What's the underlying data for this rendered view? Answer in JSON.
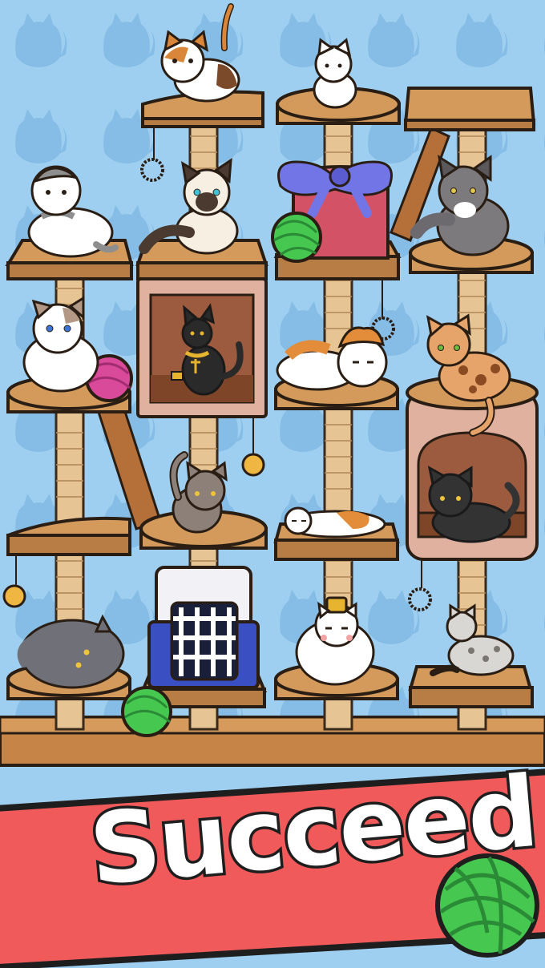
{
  "screen": {
    "title": "Succeed"
  },
  "colors": {
    "sky": "#9fcff0",
    "wallpaper_pattern": "#86bde6",
    "wood": "#d39a5c",
    "wood_edge": "#3a2a1c",
    "rope": "#e6c493",
    "banner_red": "#f05a5a",
    "yarn_green": "#45c750",
    "yarn_pink": "#d94a9a",
    "gift_box": "#d45266",
    "gift_ribbon": "#7275e6",
    "carrier_blue": "#3a4fc2",
    "cat_house": "#e1b1a0"
  },
  "cats": [
    {
      "name": "calico",
      "on": "top-left-platform"
    },
    {
      "name": "white",
      "on": "top-middle-platform"
    },
    {
      "name": "scottish-fold",
      "on": "left-platform-1"
    },
    {
      "name": "siamese",
      "on": "cat-house-roof"
    },
    {
      "name": "maine-coon",
      "on": "right-platform-1"
    },
    {
      "name": "ragdoll",
      "on": "left-platform-2"
    },
    {
      "name": "egyptian-bastet",
      "on": "cat-house"
    },
    {
      "name": "exotic-shorthair",
      "on": "middle-platform-2"
    },
    {
      "name": "bengal",
      "on": "cat-tube-top"
    },
    {
      "name": "tabby",
      "on": "left-middle-platform-3"
    },
    {
      "name": "sleeping-calico",
      "on": "middle-platform-3"
    },
    {
      "name": "black",
      "on": "cat-tube"
    },
    {
      "name": "grey-fat",
      "on": "left-platform-4"
    },
    {
      "name": "chubby-white",
      "on": "middle-platform-4"
    },
    {
      "name": "egyptian-mau",
      "on": "right-platform-4"
    }
  ],
  "toys": [
    "green-yarn-ball",
    "pink-yarn-ball",
    "gift-box",
    "pet-carrier",
    "bell",
    "pom-pom"
  ]
}
